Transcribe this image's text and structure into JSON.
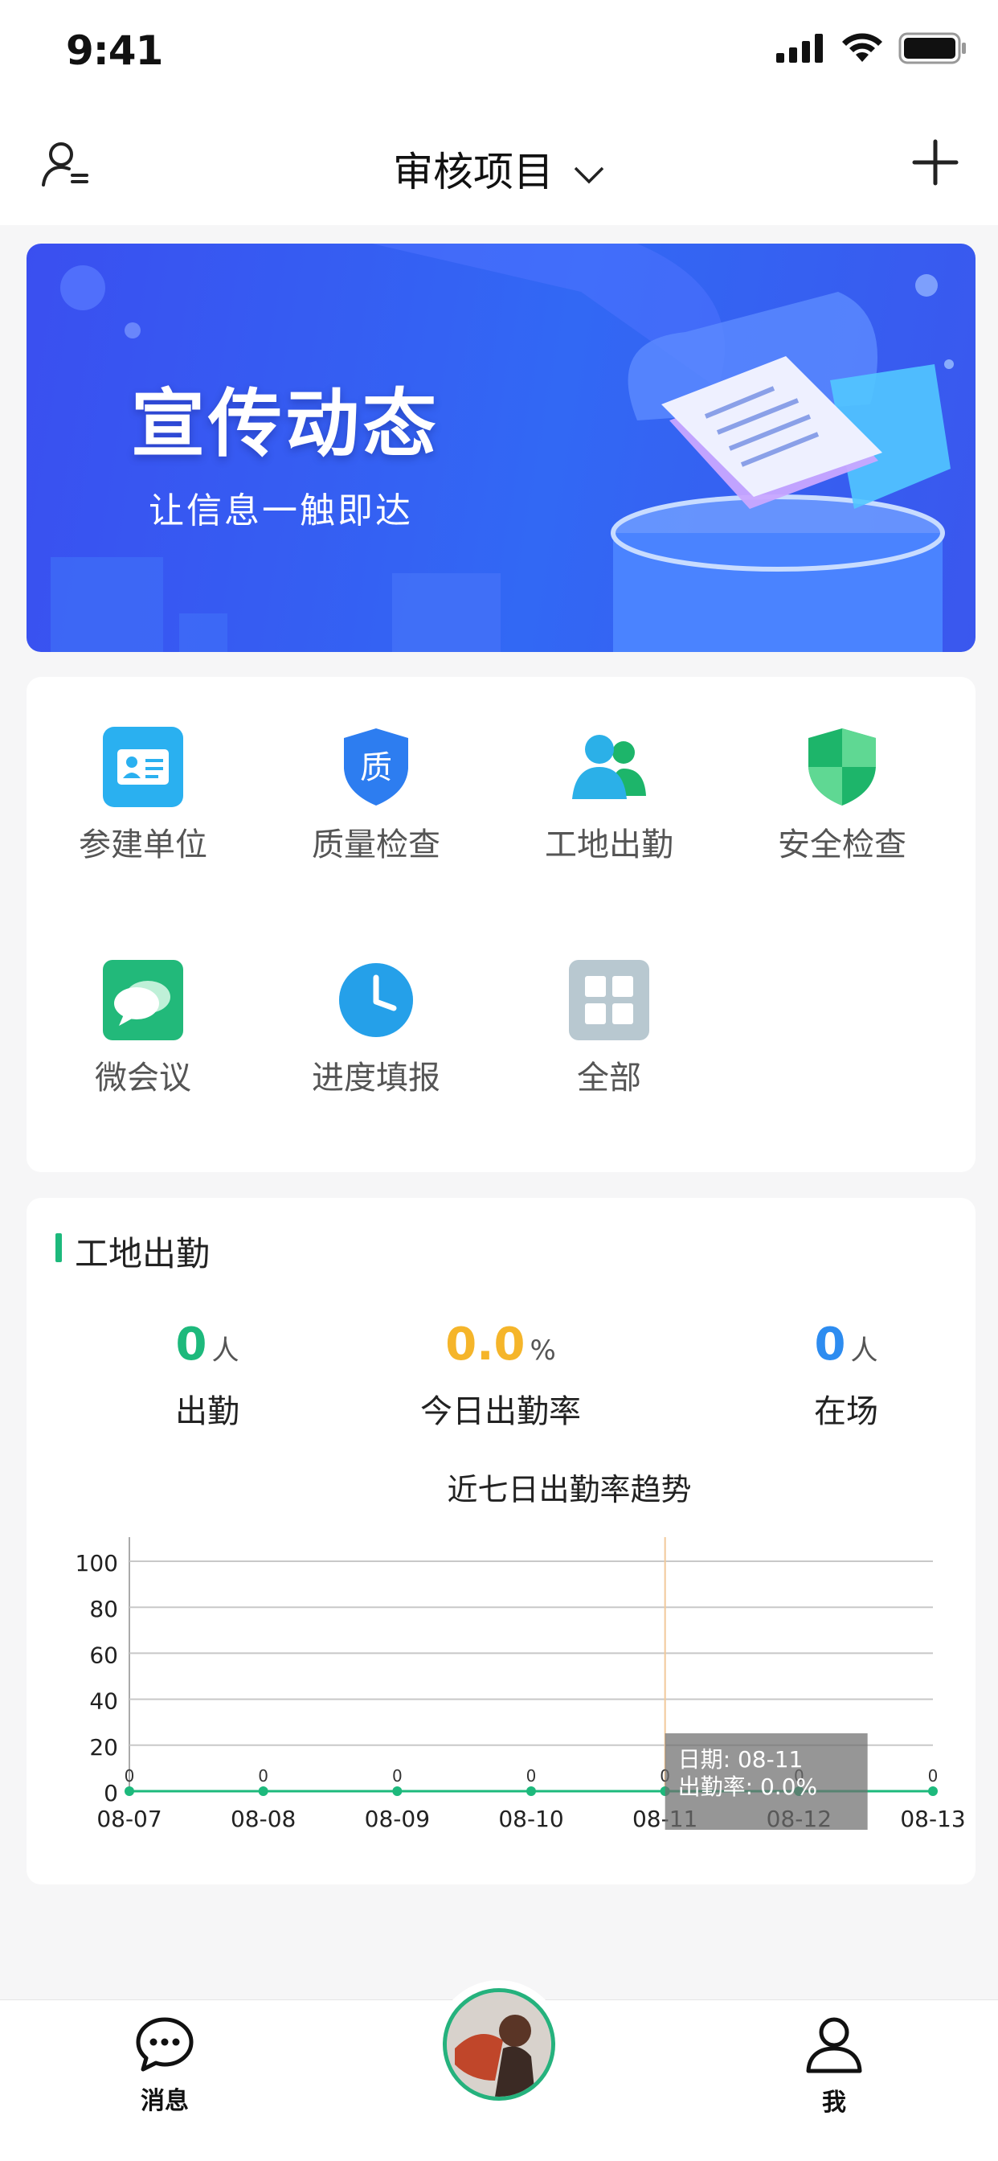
{
  "status_bar": {
    "time": "9:41"
  },
  "header": {
    "title": "审核项目"
  },
  "banner": {
    "title": "宣传动态",
    "subtitle": "让信息一触即达"
  },
  "menu": [
    {
      "label": "参建单位",
      "icon": "id-card-icon",
      "color": "#2ab0f0"
    },
    {
      "label": "质量检查",
      "icon": "quality-shield-icon",
      "color": "#2d7df0"
    },
    {
      "label": "工地出勤",
      "icon": "people-icon",
      "color": "#2bb0e8"
    },
    {
      "label": "安全检查",
      "icon": "security-shield-icon",
      "color": "#1db56a"
    },
    {
      "label": "微会议",
      "icon": "chat-bubbles-icon",
      "color": "#22b97a"
    },
    {
      "label": "进度填报",
      "icon": "clock-icon",
      "color": "#2aa9ee"
    },
    {
      "label": "全部",
      "icon": "grid-icon",
      "color": "#b8c8d0"
    }
  ],
  "quality_icon_char": "质",
  "attendance": {
    "title": "工地出勤",
    "present": {
      "value": "0",
      "unit": "人",
      "label": "出勤",
      "color": "#1db97c"
    },
    "rate": {
      "value": "0.0",
      "unit": "%",
      "label": "今日出勤率",
      "color": "#f5b52a"
    },
    "onsite": {
      "value": "0",
      "unit": "人",
      "label": "在场",
      "color": "#2d8cf0"
    }
  },
  "chart_data": {
    "type": "line",
    "title": "近七日出勤率趋势",
    "categories": [
      "08-07",
      "08-08",
      "08-09",
      "08-10",
      "08-11",
      "08-12",
      "08-13"
    ],
    "values": [
      0,
      0,
      0,
      0,
      0,
      0,
      0
    ],
    "ylim": [
      0,
      100
    ],
    "yticks": [
      0,
      20,
      40,
      60,
      80,
      100
    ],
    "grid": true,
    "line_color": "#1db97c",
    "tooltip": {
      "date_line": "日期: 08-11",
      "rate_line": "出勤率: 0.0%"
    }
  },
  "tabbar": {
    "messages_label": "消息",
    "me_label": "我"
  }
}
